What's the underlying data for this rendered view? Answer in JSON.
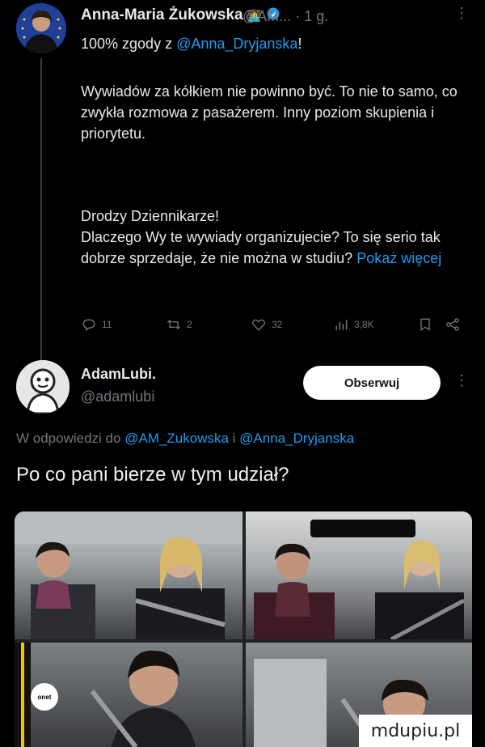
{
  "tweet1": {
    "author_name": "Anna-Maria Żukowska",
    "author_emoji": "👩‍💻",
    "handle_time": "@AM... · 1 g.",
    "agree_prefix": "100% zgody z ",
    "agree_mention": "@Anna_Dryjanska",
    "agree_suffix": "!",
    "paragraph1": "Wywiadów za kółkiem nie powinno być. To nie to samo, co zwykła rozmowa z pasażerem. Inny poziom skupienia i priorytetu.",
    "paragraph2_line1": "Drodzy Dziennikarze!",
    "paragraph2_body": "Dlaczego Wy te wywiady organizujecie? To się serio tak dobrze sprzedaje, że nie można w studiu? ",
    "show_more": "Pokaż więcej",
    "actions": {
      "replies": "11",
      "reposts": "2",
      "likes": "32",
      "views": "3,8K"
    }
  },
  "tweet2": {
    "author_name": "AdamLubi.",
    "handle": "@adamlubi",
    "follow_label": "Obserwuj",
    "reply_prefix": "W odpowiedzi do ",
    "reply_mention1": "@AM_Zukowska",
    "reply_and": " i ",
    "reply_mention2": "@Anna_Dryjanska",
    "text": "Po co pani bierze w tym udział?"
  },
  "media": {
    "logo_text": "onet",
    "watermark": "mdupiu.pl"
  },
  "colors": {
    "background": "#000000",
    "text": "#e7e9ea",
    "muted": "#71767b",
    "link": "#1d9bf0"
  }
}
